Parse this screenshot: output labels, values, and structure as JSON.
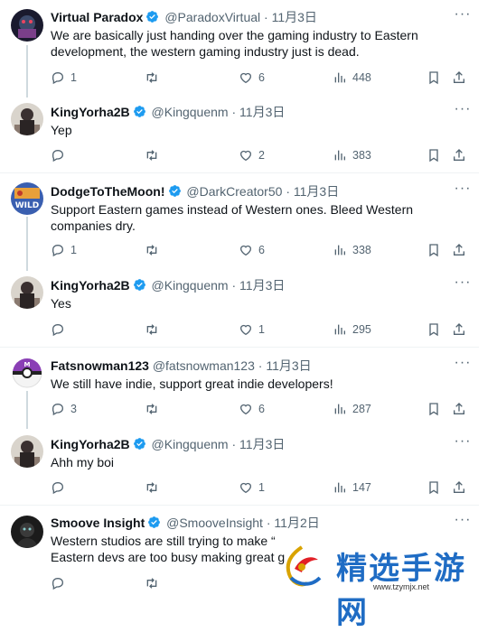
{
  "tweets": [
    {
      "name": "Virtual Paradox",
      "handle": "@ParadoxVirtual",
      "dot": "·",
      "date": "11月3日",
      "text": "We are basically just handing over the gaming industry to Eastern development, the western gaming industry just is dead.",
      "replies": "1",
      "retweets": "",
      "likes": "6",
      "views": "448"
    },
    {
      "name": "KingYorha2B",
      "handle": "@Kingquenm",
      "dot": "·",
      "date": "11月3日",
      "text": "Yep",
      "replies": "",
      "retweets": "",
      "likes": "2",
      "views": "383"
    },
    {
      "name": "DodgeToTheMoon!",
      "handle": "@DarkCreator50",
      "dot": "·",
      "date": "11月3日",
      "text": "Support Eastern games instead of Western ones. Bleed Western companies dry.",
      "replies": "1",
      "retweets": "",
      "likes": "6",
      "views": "338"
    },
    {
      "name": "KingYorha2B",
      "handle": "@Kingquenm",
      "dot": "·",
      "date": "11月3日",
      "text": "Yes",
      "replies": "",
      "retweets": "",
      "likes": "1",
      "views": "295"
    },
    {
      "name": "Fatsnowman123",
      "handle": "@fatsnowman123",
      "dot": "·",
      "date": "11月3日",
      "text": "We still have indie, support great indie developers!",
      "replies": "3",
      "retweets": "",
      "likes": "6",
      "views": "287"
    },
    {
      "name": "KingYorha2B",
      "handle": "@Kingquenm",
      "dot": "·",
      "date": "11月3日",
      "text": "Ahh my boi",
      "replies": "",
      "retweets": "",
      "likes": "1",
      "views": "147"
    },
    {
      "name": "Smoove Insight",
      "handle": "@SmooveInsight",
      "dot": "·",
      "date": "11月2日",
      "text": "Western studios are still trying to make “\nEastern devs are too busy making great g",
      "replies": "",
      "retweets": "",
      "likes": "",
      "views": ""
    }
  ],
  "watermark": {
    "text": "精选手游网",
    "url": "www.tzymjx.net"
  },
  "colors": {
    "text": "#0f1419",
    "secondary": "#536471",
    "verified": "#1d9bf0",
    "divider": "#eff3f4",
    "thread": "#cfd9de",
    "watermark": "#1f6cc4"
  }
}
